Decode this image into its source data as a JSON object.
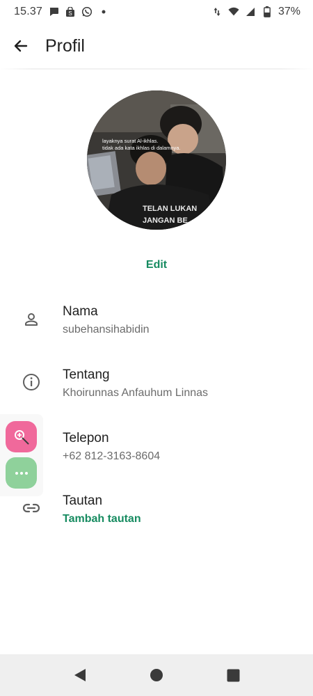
{
  "status_bar": {
    "time": "15.37",
    "battery": "37%",
    "left_icons": [
      "chat-bubble-icon",
      "shop-bag-icon",
      "whatsapp-icon",
      "dot-icon"
    ],
    "right_icons": [
      "data-arrows-icon",
      "wifi-icon",
      "signal-icon",
      "battery-icon"
    ]
  },
  "app_bar": {
    "title": "Profil",
    "back_icon": "arrow-left-icon"
  },
  "profile": {
    "photo_caption_line1": "layaknya surat Al-ikhlas.",
    "photo_caption_line2": "tidak ada kata ikhlas di dalamnya.",
    "shirt_text_line1": "TELAN LUKAN",
    "shirt_text_line2": "JANGAN BE",
    "edit_label": "Edit"
  },
  "rows": [
    {
      "icon": "person-icon",
      "label": "Nama",
      "value": "subehansihabidin"
    },
    {
      "icon": "info-icon",
      "label": "Tentang",
      "value": "Khoirunnas Anfauhum Linnas"
    },
    {
      "icon": "phone-icon",
      "label": "Telepon",
      "value": "+62 812-3163-8604"
    },
    {
      "icon": "link-icon",
      "label": "Tautan",
      "value": "Tambah tautan"
    }
  ],
  "floating": {
    "top_icon": "zoom-in-icon",
    "bottom_icon": "more-dots-icon"
  },
  "nav": {
    "icons": [
      "back-triangle-icon",
      "home-circle-icon",
      "recents-square-icon"
    ]
  },
  "colors": {
    "accent": "#168b60",
    "pink_bubble": "#f0699b",
    "green_bubble": "#8fd19b",
    "nav_bg": "#efefef"
  }
}
